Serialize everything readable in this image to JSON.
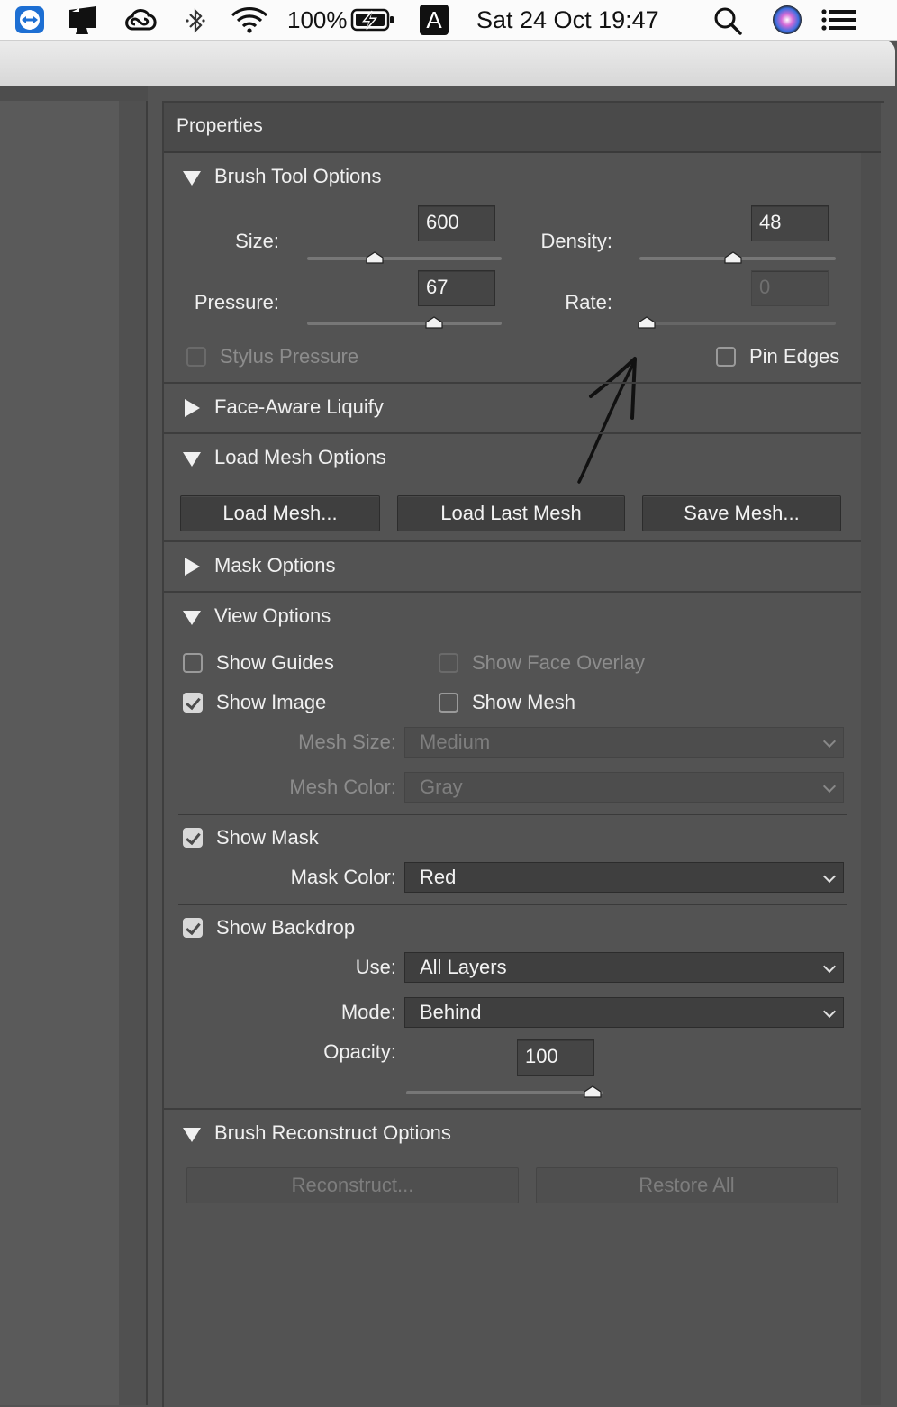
{
  "menubar": {
    "battery": "100%",
    "input_source": "A",
    "datetime": "Sat 24 Oct  19:47"
  },
  "panel": {
    "title": "Properties",
    "brush_tool_options": {
      "title": "Brush Tool Options",
      "size": {
        "label": "Size:",
        "value": "600",
        "slider_fraction": 0.35
      },
      "density": {
        "label": "Density:",
        "value": "48",
        "slider_fraction": 0.48
      },
      "pressure": {
        "label": "Pressure:",
        "value": "67",
        "slider_fraction": 0.65
      },
      "rate": {
        "label": "Rate:",
        "value": "0",
        "slider_fraction": 0.0
      },
      "stylus_pressure": "Stylus Pressure",
      "pin_edges": "Pin Edges"
    },
    "face_aware_liquify": {
      "title": "Face-Aware Liquify"
    },
    "load_mesh_options": {
      "title": "Load Mesh Options",
      "load_mesh": "Load Mesh...",
      "load_last_mesh": "Load Last Mesh",
      "save_mesh": "Save Mesh..."
    },
    "mask_options": {
      "title": "Mask Options"
    },
    "view_options": {
      "title": "View Options",
      "show_guides": "Show Guides",
      "show_face_overlay": "Show Face Overlay",
      "show_image": "Show Image",
      "show_mesh": "Show Mesh",
      "mesh_size": {
        "label": "Mesh Size:",
        "value": "Medium"
      },
      "mesh_color": {
        "label": "Mesh Color:",
        "value": "Gray"
      },
      "show_mask": "Show Mask",
      "mask_color": {
        "label": "Mask Color:",
        "value": "Red"
      },
      "show_backdrop": "Show Backdrop",
      "use": {
        "label": "Use:",
        "value": "All Layers"
      },
      "mode": {
        "label": "Mode:",
        "value": "Behind"
      },
      "opacity": {
        "label": "Opacity:",
        "value": "100",
        "slider_fraction": 1.0
      }
    },
    "brush_reconstruct_options": {
      "title": "Brush Reconstruct Options",
      "reconstruct": "Reconstruct...",
      "restore_all": "Restore All"
    }
  },
  "colors": {
    "panel_bg": "#535353",
    "header_bg": "#4a4a4a",
    "text": "#f0f0f0",
    "disabled_text": "#8c8c8c"
  }
}
